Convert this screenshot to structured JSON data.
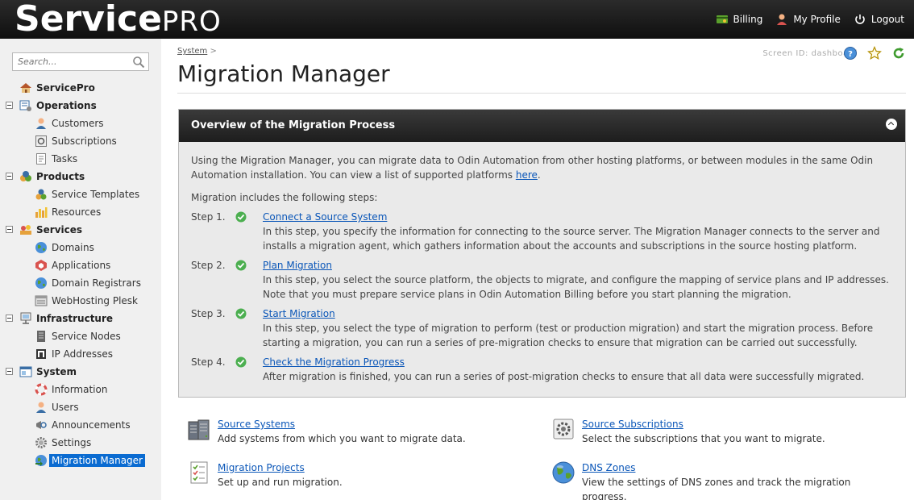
{
  "header": {
    "logo_bold": "Service",
    "logo_light": "PRO",
    "billing": "Billing",
    "profile": "My Profile",
    "logout": "Logout"
  },
  "search": {
    "placeholder": "Search..."
  },
  "nav": {
    "root": "ServicePro",
    "operations": "Operations",
    "customers": "Customers",
    "subscriptions": "Subscriptions",
    "tasks": "Tasks",
    "products": "Products",
    "service_templates": "Service Templates",
    "resources": "Resources",
    "services": "Services",
    "domains": "Domains",
    "applications": "Applications",
    "domain_registrars": "Domain Registrars",
    "webhosting_plesk": "WebHosting Plesk",
    "infrastructure": "Infrastructure",
    "service_nodes": "Service Nodes",
    "ip_addresses": "IP Addresses",
    "system": "System",
    "information": "Information",
    "users": "Users",
    "announcements": "Announcements",
    "settings": "Settings",
    "migration_manager": "Migration Manager"
  },
  "page": {
    "breadcrumb_link": "System",
    "breadcrumb_sep": ">",
    "title": "Migration Manager",
    "screen_id_label": "Screen ID:",
    "screen_id_value": "dashboard"
  },
  "overview": {
    "title": "Overview of the Migration Process",
    "intro": "Using the Migration Manager, you can migrate data to Odin Automation from other hosting platforms, or between modules in the same Odin Automation installation. You can view a list of supported platforms ",
    "intro_link": "here",
    "intro_end": ".",
    "steps_intro": "Migration includes the following steps:",
    "steps": [
      {
        "num": "Step 1.",
        "link": "Connect a Source System",
        "desc": "In this step, you specify the information for connecting to the source server. The Migration Manager connects to the server and installs a migration agent, which gathers information about the accounts and subscriptions in the source hosting platform."
      },
      {
        "num": "Step 2.",
        "link": "Plan Migration",
        "desc": "In this step, you select the source platform, the objects to migrate, and configure the mapping of service plans and IP addresses. Note that you must prepare service plans in Odin Automation Billing before you start planning the migration."
      },
      {
        "num": "Step 3.",
        "link": "Start Migration",
        "desc": "In this step, you select the type of migration to perform (test or production migration) and start the migration process. Before starting a migration, you can run a series of pre-migration checks to ensure that migration can be carried out successfully."
      },
      {
        "num": "Step 4.",
        "link": "Check the Migration Progress",
        "desc": "After migration is finished, you can run a series of post-migration checks to ensure that all data were successfully migrated."
      }
    ]
  },
  "quick_links": {
    "source_systems": {
      "label": "Source Systems",
      "desc": "Add systems from which you want to migrate data."
    },
    "source_subscriptions": {
      "label": "Source Subscriptions",
      "desc": "Select the subscriptions that you want to migrate."
    },
    "migration_projects": {
      "label": "Migration Projects",
      "desc": "Set up and run migration."
    },
    "dns_zones": {
      "label": "DNS Zones",
      "desc": "View the settings of DNS zones and track the migration progress."
    }
  }
}
